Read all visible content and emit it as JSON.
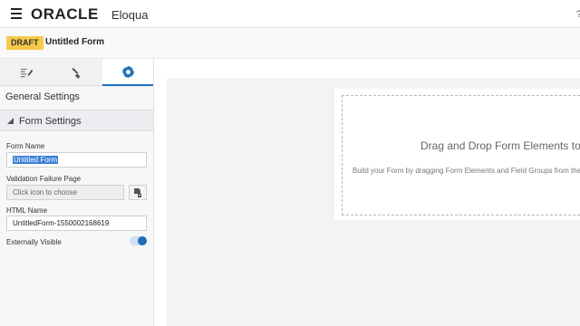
{
  "header": {
    "logo": "ORACLE",
    "product": "Eloqua",
    "right_text": "?"
  },
  "subbar": {
    "status_badge": "DRAFT",
    "form_title": "Untitled Form"
  },
  "sidebar": {
    "tabs": [
      {
        "icon": "form-icon"
      },
      {
        "icon": "brush-icon"
      },
      {
        "icon": "gear-icon",
        "active": true
      }
    ],
    "general_settings": "General Settings",
    "section_title": "Form Settings",
    "fields": {
      "form_name_label": "Form Name",
      "form_name_value": "Untitled Form",
      "validation_label": "Validation Failure Page",
      "validation_placeholder": "Click icon to choose",
      "html_name_label": "HTML Name",
      "html_name_value": "UntitledForm-1550002168619",
      "externally_visible_label": "Externally Visible",
      "externally_visible": true
    }
  },
  "canvas": {
    "drop_title": "Drag and Drop Form Elements to",
    "drop_subtitle": "Build your Form by dragging Form Elements and Field Groups from the"
  },
  "colors": {
    "accent": "#1f6fb8",
    "draft_badge": "#f6c94a"
  }
}
